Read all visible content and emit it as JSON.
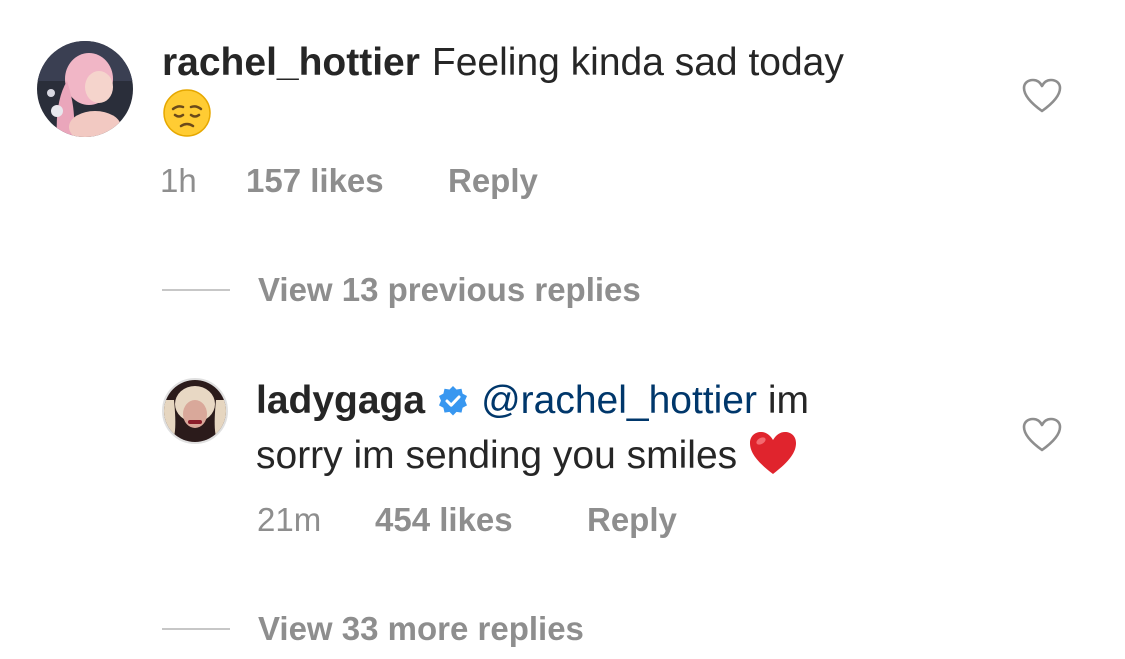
{
  "comment": {
    "username": "rachel_hottier",
    "text": "Feeling kinda sad today",
    "emoji": "pensive-face-emoji",
    "time": "1h",
    "likes": "157 likes",
    "reply_label": "Reply"
  },
  "view_previous": {
    "label": "View 13 previous replies"
  },
  "reply": {
    "username": "ladygaga",
    "verified": true,
    "mention": "@rachel_hottier",
    "text_line1": "im",
    "text_line2": "sorry im sending you smiles",
    "emoji": "red-heart-emoji",
    "time": "21m",
    "likes": "454 likes",
    "reply_label": "Reply"
  },
  "view_more": {
    "label": "View 33 more replies"
  },
  "colors": {
    "text": "#262626",
    "secondary": "#8e8e8e",
    "mention": "#00376b",
    "verified": "#3897f0",
    "divider": "#c7c7c7"
  }
}
